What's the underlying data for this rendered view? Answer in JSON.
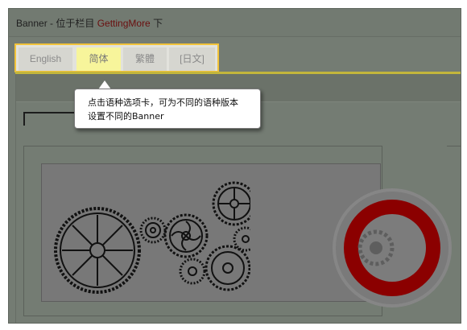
{
  "title": {
    "prefix": "Banner - 位于栏目 ",
    "link": "GettingMore",
    "suffix": " 下"
  },
  "tabs": [
    {
      "label": "English",
      "active": false
    },
    {
      "label": "简体",
      "active": true
    },
    {
      "label": "繁體",
      "active": false
    },
    {
      "label": "[日文]",
      "active": false
    }
  ],
  "tooltip": {
    "line1": "点击语种选项卡，可为不同的语种版本",
    "line2": "设置不同的Banner"
  },
  "colors": {
    "highlight_border": "#f2c33a",
    "active_tab": "#f7f59b",
    "overlay": "#747c73",
    "red": "#8b0000"
  }
}
